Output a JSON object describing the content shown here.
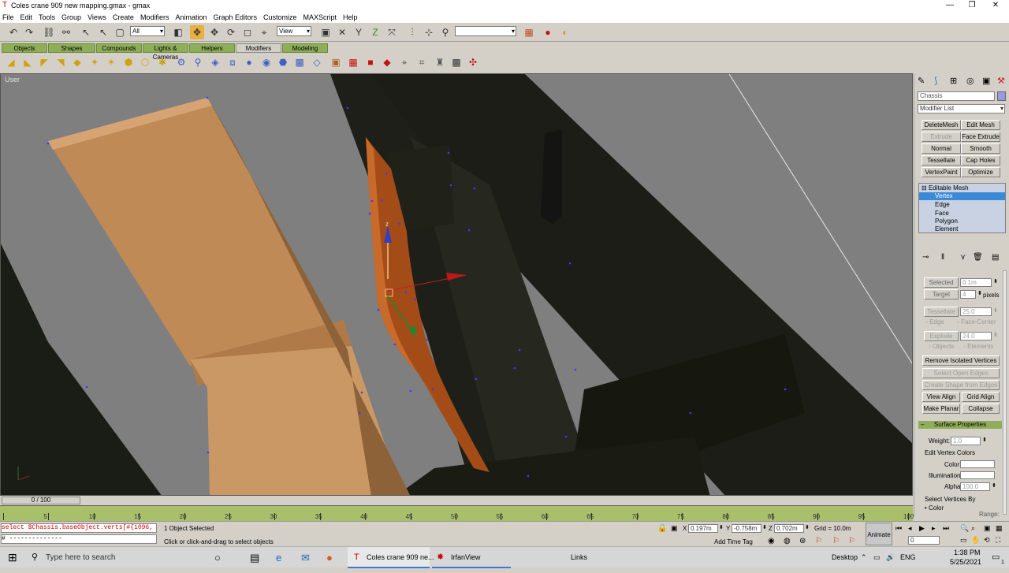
{
  "window": {
    "title": "Coles crane 909 new mapping.gmax - gmax"
  },
  "menu": [
    "File",
    "Edit",
    "Tools",
    "Group",
    "Views",
    "Create",
    "Modifiers",
    "Animation",
    "Graph Editors",
    "Customize",
    "MAXScript",
    "Help"
  ],
  "toolbar": {
    "filter_value": "All",
    "ref_coord_value": "View",
    "named_sel_value": ""
  },
  "tabs": [
    "Objects",
    "Shapes",
    "Compounds",
    "Lights & Cameras",
    "Helpers",
    "Modifiers",
    "Modeling"
  ],
  "active_tab": "Modifiers",
  "viewport": {
    "label": "User",
    "gizmo_axis_label": "z"
  },
  "command_panel": {
    "object_name": "Chassis",
    "modifier_list": "Modifier List",
    "modifier_buttons": [
      {
        "label": "DeleteMesh",
        "enabled": true
      },
      {
        "label": "Edit Mesh",
        "enabled": true
      },
      {
        "label": "Extrude",
        "enabled": false
      },
      {
        "label": "Face Extrude",
        "enabled": true
      },
      {
        "label": "Normal",
        "enabled": true
      },
      {
        "label": "Smooth",
        "enabled": true
      },
      {
        "label": "Tessellate",
        "enabled": true
      },
      {
        "label": "Cap Holes",
        "enabled": true
      },
      {
        "label": "VertexPaint",
        "enabled": true
      },
      {
        "label": "Optimize",
        "enabled": true
      }
    ],
    "stack": {
      "base": "Editable Mesh",
      "items": [
        "Vertex",
        "Edge",
        "Face",
        "Polygon",
        "Element"
      ],
      "selected": "Vertex"
    },
    "weld": {
      "selected_label": "Selected",
      "selected_value": "0.1m",
      "target_label": "Target",
      "target_value": "4",
      "pixels_label": "pixels"
    },
    "tessellate": {
      "button": "Tessellate",
      "value": "25.0",
      "edge_label": "Edge",
      "face_center_label": "Face-Center"
    },
    "explode": {
      "button": "Explode",
      "value": "24.0",
      "objects_label": "Objects",
      "elements_label": "Elements"
    },
    "buttons": {
      "remove_isolated": "Remove Isolated Vertices",
      "select_open_edges": "Select Open Edges",
      "create_shape": "Create Shape from Edges",
      "view_align": "View Align",
      "grid_align": "Grid Align",
      "make_planar": "Make Planar",
      "collapse": "Collapse"
    },
    "surface": {
      "title": "Surface Properties",
      "weight_label": "Weight:",
      "weight_value": "1.0",
      "edit_colors_label": "Edit Vertex Colors",
      "color_label": "Color:",
      "illumination_label": "Illumination:",
      "alpha_label": "Alpha:",
      "alpha_value": "100.0",
      "select_by_label": "Select Vertices By",
      "color_radio": "Color",
      "range_label": "Range:"
    }
  },
  "timeline": {
    "slider_label": "0 / 100",
    "ticks": [
      "0",
      "5",
      "10",
      "15",
      "20",
      "25",
      "30",
      "35",
      "40",
      "45",
      "50",
      "55",
      "60",
      "65",
      "70",
      "75",
      "80",
      "85",
      "90",
      "95",
      "100"
    ]
  },
  "status": {
    "maxscript_line1": "select $Chassis.baseObject.verts[#{1096, 5",
    "maxscript_line2": "# --------------",
    "selection": "1 Object Selected",
    "prompt": "Click or click-and-drag to select objects",
    "x_label": "X",
    "x_value": "0.197m",
    "y_label": "Y",
    "y_value": "-0.758m",
    "z_label": "Z",
    "z_value": "0.702m",
    "grid": "Grid = 10.0m",
    "add_time_tag": "Add Time Tag",
    "animate": "Animate",
    "frame_value": "0"
  },
  "taskbar": {
    "search_placeholder": "Type here to search",
    "tasks": [
      "Coles crane 909 ne...",
      "IrfanView"
    ],
    "links": "Links",
    "desktop": "Desktop",
    "lang": "ENG",
    "time": "1:38 PM",
    "date": "5/25/2021",
    "notification_count": "1"
  }
}
